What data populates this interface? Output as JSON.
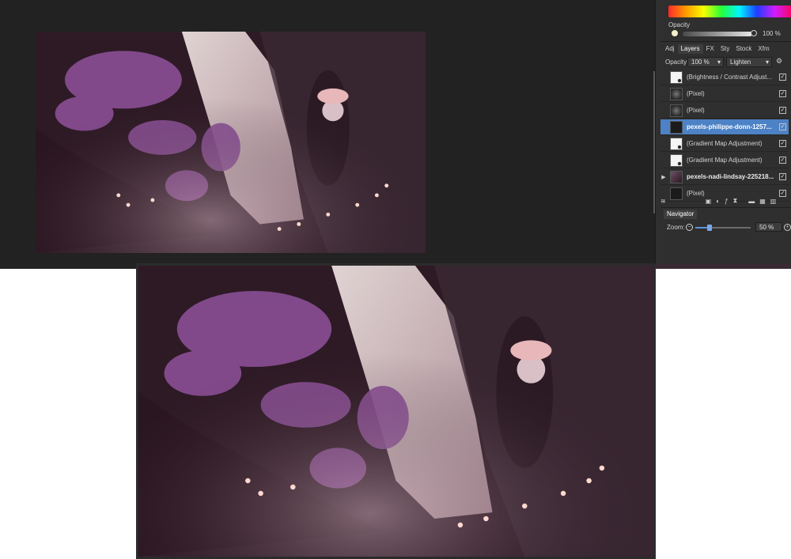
{
  "colors": {
    "workspace": "#222222",
    "panel": "#2f2f2f",
    "selected": "#4d82c6",
    "accent_zoom": "#5a93e0"
  },
  "opacity_panel": {
    "title": "Opacity",
    "value": "100 %",
    "level": 1.0
  },
  "tabs": [
    "Adj",
    "Layers",
    "FX",
    "Sty",
    "Stock",
    "Xfm"
  ],
  "active_tab": "Layers",
  "layer_controls": {
    "opacity_label": "Opacity:",
    "opacity_value": "100 %",
    "blend_mode": "Lighten"
  },
  "layers": [
    {
      "name": "(Brightness / Contrast Adjust...",
      "thumb": "white",
      "adjustment": true,
      "checked": true,
      "selected": false,
      "bold": false,
      "expandable": false
    },
    {
      "name": "(Pixel)",
      "thumb": "pixel",
      "adjustment": false,
      "checked": true,
      "selected": false,
      "bold": false,
      "expandable": false
    },
    {
      "name": "(Pixel)",
      "thumb": "pixel",
      "adjustment": false,
      "checked": true,
      "selected": false,
      "bold": false,
      "expandable": false
    },
    {
      "name": "pexels-philippe-donn-1257...",
      "thumb": "dark",
      "adjustment": false,
      "checked": true,
      "selected": true,
      "bold": true,
      "expandable": false
    },
    {
      "name": "(Gradient Map Adjustment)",
      "thumb": "white",
      "adjustment": true,
      "checked": true,
      "selected": false,
      "bold": false,
      "expandable": false
    },
    {
      "name": "(Gradient Map Adjustment)",
      "thumb": "white",
      "adjustment": true,
      "checked": true,
      "selected": false,
      "bold": false,
      "expandable": false
    },
    {
      "name": "pexels-nadi-lindsay-225218...",
      "thumb": "photo",
      "adjustment": false,
      "checked": true,
      "selected": false,
      "bold": true,
      "expandable": true
    },
    {
      "name": "(Pixel)",
      "thumb": "dark",
      "adjustment": false,
      "checked": true,
      "selected": false,
      "bold": false,
      "expandable": false
    }
  ],
  "toolbar_icons": [
    "layers-stack-icon",
    "mask-icon",
    "adjustment-icon",
    "fx-icon",
    "live-filter-icon",
    "folder-icon",
    "group-icon",
    "trash-icon"
  ],
  "navigator": {
    "tab": "Navigator",
    "zoom_label": "Zoom:",
    "zoom_value": "50 %",
    "zoom_level": 0.25
  }
}
